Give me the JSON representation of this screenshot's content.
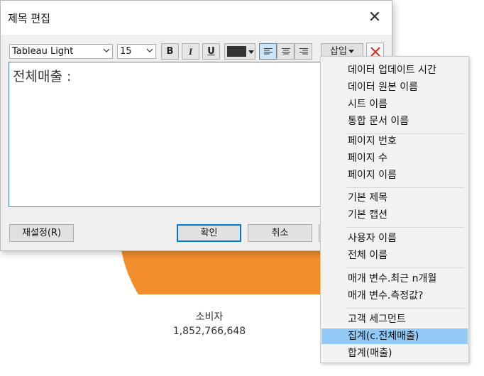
{
  "dialog": {
    "title": "제목 편집",
    "close_glyph": "✕",
    "toolbar": {
      "font_family": "Tableau Light",
      "font_size": "15",
      "bold_label": "B",
      "italic_label": "I",
      "underline_label": "U",
      "text_color": "#333333",
      "alignment": "left",
      "insert_label": "삽입"
    },
    "editor_text": "전체매출 :",
    "buttons": {
      "reset": "재설정(R)",
      "ok": "확인",
      "cancel": "취소"
    }
  },
  "insert_menu": {
    "groups": [
      [
        "데이터 업데이트 시간",
        "데이터 원본 이름",
        "시트 이름",
        "통합 문서 이름"
      ],
      [
        "페이지 번호",
        "페이지 수",
        "페이지 이름"
      ],
      [
        "기본 제목",
        "기본 캡션"
      ],
      [
        "사용자 이름",
        "전체 이름"
      ],
      [
        "매개 변수.최근 n개월",
        "매개 변수.측정값?"
      ],
      [
        "고객 세그먼트",
        "집계(c.전체매출)",
        "합계(매출)"
      ]
    ],
    "highlighted_item": "집계(c.전체매출)"
  },
  "worksheet": {
    "pie_color": "#f28e2b",
    "segment_label": "소비자",
    "segment_value": "1,852,766,648"
  }
}
